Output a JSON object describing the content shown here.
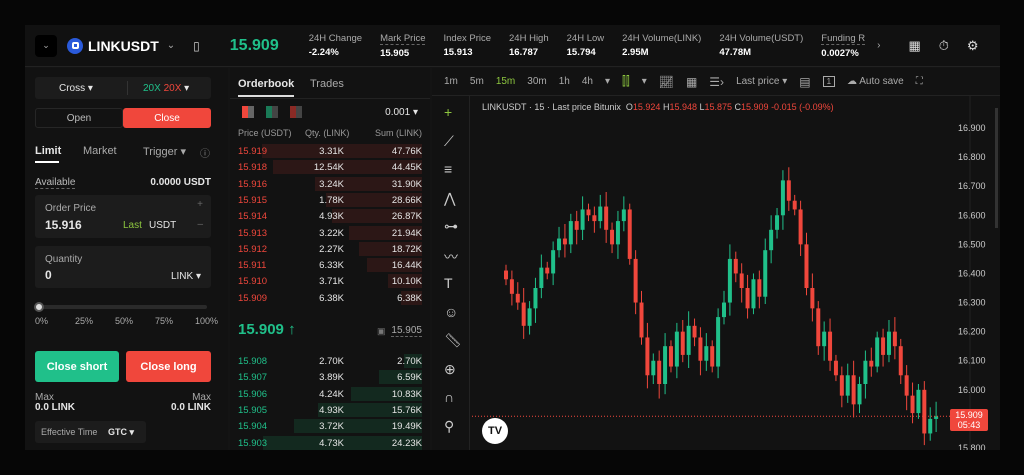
{
  "header": {
    "symbol": "LINKUSDT",
    "last_price": "15.909",
    "stats": [
      {
        "label": "24H Change",
        "value": "-2.24%",
        "color": "red"
      },
      {
        "label": "Mark Price",
        "value": "15.905"
      },
      {
        "label": "Index Price",
        "value": "15.913"
      },
      {
        "label": "24H High",
        "value": "16.787"
      },
      {
        "label": "24H Low",
        "value": "15.794"
      },
      {
        "label": "24H Volume(LINK)",
        "value": "2.95M"
      },
      {
        "label": "24H Volume(USDT)",
        "value": "47.78M"
      },
      {
        "label": "Funding R",
        "value": "0.0027%",
        "color": "green"
      }
    ]
  },
  "order": {
    "margin_mode": "Cross",
    "lev_long": "20X",
    "lev_short": "20X",
    "open": "Open",
    "close": "Close",
    "tabs": [
      "Limit",
      "Market",
      "Trigger"
    ],
    "available_label": "Available",
    "available": "0.0000 USDT",
    "price_label": "Order Price",
    "price": "15.916",
    "last": "Last",
    "price_unit": "USDT",
    "qty_label": "Quantity",
    "qty": "0",
    "qty_unit": "LINK",
    "slider": [
      "0%",
      "25%",
      "50%",
      "75%",
      "100%"
    ],
    "slider_value": 0,
    "close_short": "Close short",
    "close_long": "Close long",
    "max_label": "Max",
    "max_short": "0.0 LINK",
    "max_long": "0.0 LINK",
    "eff_label": "Effective Time",
    "eff": "GTC"
  },
  "orderbook": {
    "tabs": [
      "Orderbook",
      "Trades"
    ],
    "precision": "0.001",
    "cols": [
      "Price (USDT)",
      "Qty. (LINK)",
      "Sum (LINK)"
    ],
    "asks": [
      [
        "15.919",
        "3.31K",
        "47.76K"
      ],
      [
        "15.918",
        "12.54K",
        "44.45K"
      ],
      [
        "15.916",
        "3.24K",
        "31.90K"
      ],
      [
        "15.915",
        "1.78K",
        "28.66K"
      ],
      [
        "15.914",
        "4.93K",
        "26.87K"
      ],
      [
        "15.913",
        "3.22K",
        "21.94K"
      ],
      [
        "15.912",
        "2.27K",
        "18.72K"
      ],
      [
        "15.911",
        "6.33K",
        "16.44K"
      ],
      [
        "15.910",
        "3.71K",
        "10.10K"
      ],
      [
        "15.909",
        "6.38K",
        "6.38K"
      ]
    ],
    "mid": "15.909",
    "mid_arrow": "↑",
    "mark": "15.905",
    "bids": [
      [
        "15.908",
        "2.70K",
        "2.70K"
      ],
      [
        "15.907",
        "3.89K",
        "6.59K"
      ],
      [
        "15.906",
        "4.24K",
        "10.83K"
      ],
      [
        "15.905",
        "4.93K",
        "15.76K"
      ],
      [
        "15.904",
        "3.72K",
        "19.49K"
      ],
      [
        "15.903",
        "4.73K",
        "24.23K"
      ]
    ]
  },
  "toolbar": {
    "intervals": [
      "1m",
      "5m",
      "15m",
      "30m",
      "1h",
      "4h"
    ],
    "active": "15m",
    "price_type": "Last price",
    "autosave": "Auto save"
  },
  "chart_data": {
    "type": "candlestick",
    "legend": {
      "title": "LINKUSDT · 15 · Last price Bitunix",
      "o": "15.924",
      "h": "15.948",
      "l": "15.875",
      "c": "15.909",
      "chg": "-0.015 (-0.09%)"
    },
    "yticks": [
      "16.900",
      "16.800",
      "16.700",
      "16.600",
      "16.500",
      "16.400",
      "16.300",
      "16.200",
      "16.100",
      "16.000",
      "15.900",
      "15.800"
    ],
    "ylim": [
      15.78,
      16.92
    ],
    "last_label": "15.909",
    "countdown": "05:43",
    "last": 15.909,
    "closes": [
      16.38,
      16.33,
      16.3,
      16.22,
      16.28,
      16.35,
      16.42,
      16.4,
      16.48,
      16.52,
      16.5,
      16.58,
      16.55,
      16.62,
      16.6,
      16.58,
      16.63,
      16.55,
      16.5,
      16.58,
      16.62,
      16.45,
      16.3,
      16.18,
      16.05,
      16.1,
      16.02,
      16.15,
      16.08,
      16.2,
      16.12,
      16.22,
      16.18,
      16.1,
      16.15,
      16.08,
      16.25,
      16.3,
      16.45,
      16.4,
      16.35,
      16.28,
      16.38,
      16.32,
      16.48,
      16.55,
      16.6,
      16.72,
      16.65,
      16.62,
      16.5,
      16.35,
      16.28,
      16.15,
      16.2,
      16.1,
      16.05,
      15.98,
      16.05,
      15.95,
      16.02,
      16.1,
      16.08,
      16.18,
      16.12,
      16.2,
      16.15,
      16.05,
      15.98,
      15.92,
      16.0,
      15.85,
      15.9,
      15.909
    ]
  }
}
